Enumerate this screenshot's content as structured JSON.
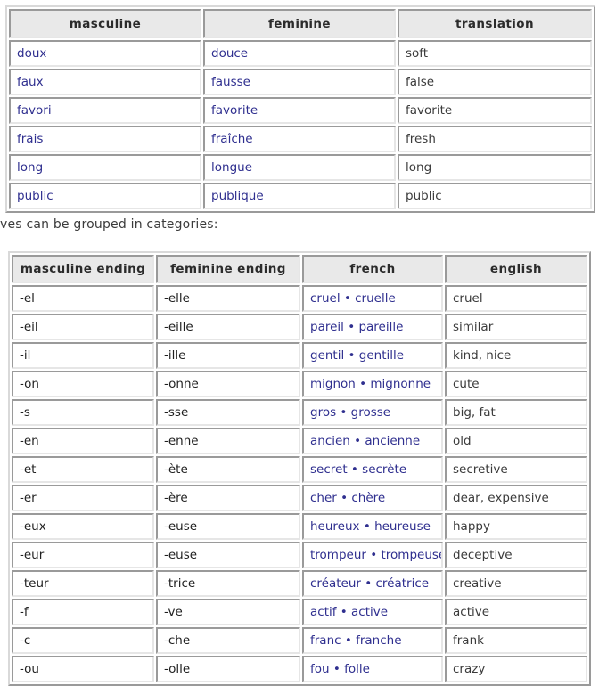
{
  "page": {
    "intro_text": "ves can be grouped in categories:"
  },
  "colors": {
    "french_blue": "#2f2f8f",
    "header_bg": "#e9e9e9",
    "body_text": "#3b3b3b",
    "border_dark": "#9a9a9a",
    "border_light": "#e6e6e6",
    "page_bg": "#ffffff"
  },
  "adjective_table": {
    "name": "irregular-adjectives-table",
    "headers": [
      "masculine",
      "feminine",
      "translation"
    ],
    "rows": [
      [
        "doux",
        "douce",
        "soft"
      ],
      [
        "faux",
        "fausse",
        "false"
      ],
      [
        "favori",
        "favorite",
        "favorite"
      ],
      [
        "frais",
        "fraîche",
        "fresh"
      ],
      [
        "long",
        "longue",
        "long"
      ],
      [
        "public",
        "publique",
        "public"
      ]
    ]
  },
  "endings_table": {
    "name": "adjective-endings-table",
    "headers": [
      "masculine ending",
      "feminine ending",
      "french",
      "english"
    ],
    "separator": "•",
    "rows": [
      [
        "-el",
        "-elle",
        "cruel • cruelle",
        "cruel"
      ],
      [
        "-eil",
        "-eille",
        "pareil • pareille",
        "similar"
      ],
      [
        "-il",
        "-ille",
        "gentil • gentille",
        "kind, nice"
      ],
      [
        "-on",
        "-onne",
        "mignon • mignonne",
        "cute"
      ],
      [
        "-s",
        "-sse",
        "gros • grosse",
        "big, fat"
      ],
      [
        "-en",
        "-enne",
        "ancien • ancienne",
        "old"
      ],
      [
        "-et",
        "-ète",
        "secret • secrète",
        "secretive"
      ],
      [
        "-er",
        "-ère",
        "cher • chère",
        "dear, expensive"
      ],
      [
        "-eux",
        "-euse",
        "heureux • heureuse",
        "happy"
      ],
      [
        "-eur",
        "-euse",
        "trompeur • trompeuse",
        "deceptive"
      ],
      [
        "-teur",
        "-trice",
        "créateur • créatrice",
        "creative"
      ],
      [
        "-f",
        "-ve",
        "actif • active",
        "active"
      ],
      [
        "-c",
        "-che",
        "franc • franche",
        "frank"
      ],
      [
        "-ou",
        "-olle",
        "fou • folle",
        "crazy"
      ]
    ]
  }
}
